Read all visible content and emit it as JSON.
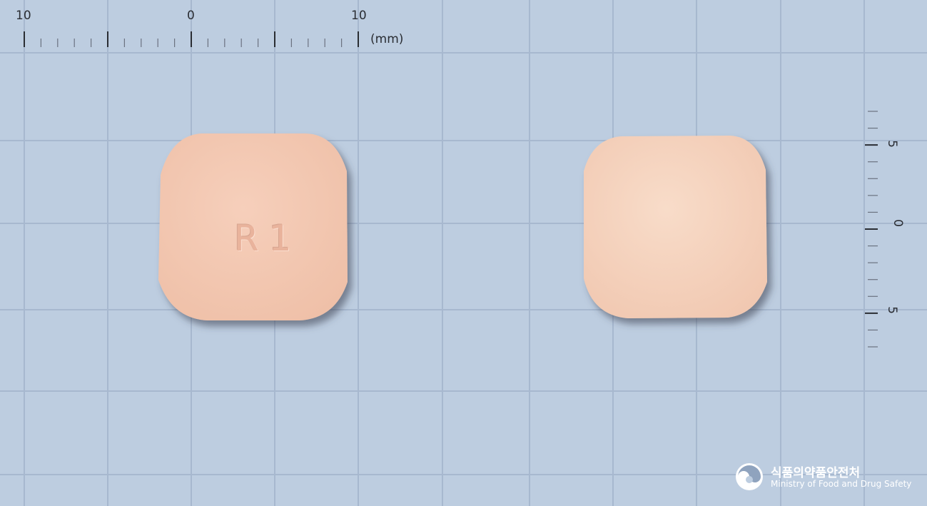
{
  "ruler_top": {
    "labels": [
      "10",
      "0",
      "10"
    ],
    "unit": "(mm)"
  },
  "ruler_right": {
    "labels": [
      "5",
      "0",
      "5"
    ]
  },
  "tablets": [
    {
      "side": "front",
      "imprint": "R1",
      "color": "#f3c7b1"
    },
    {
      "side": "back",
      "imprint": "",
      "color": "#f5d2bd"
    }
  ],
  "brand": {
    "korean": "식품의약품안전처",
    "english": "Ministry of Food and Drug Safety"
  },
  "colors": {
    "background": "#bdcde0",
    "grid": "#a7b8cf",
    "ruler": "#2a2d33"
  }
}
